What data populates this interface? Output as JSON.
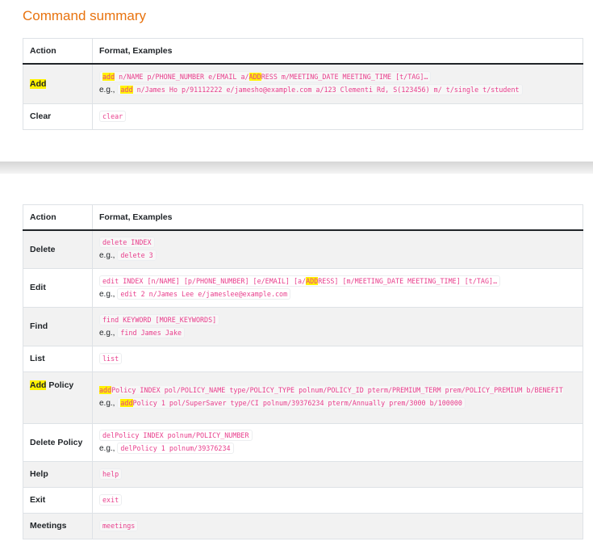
{
  "page_title": "Command summary",
  "table1": {
    "headers": {
      "action": "Action",
      "format": "Format, Examples"
    },
    "add": {
      "action": "Add",
      "cmd": "add",
      "format_rest_1": " n/NAME p/PHONE_NUMBER e/EMAIL a/",
      "format_hl": "ADD",
      "format_rest_2": "RESS m/MEETING_DATE MEETING_TIME [t/TAG]…",
      "eg_label": "e.g.,",
      "eg_cmd": "add",
      "eg_rest": " n/James Ho p/91112222 e/jamesho@example.com a/123 Clementi Rd, S(123456) m/ t/single t/student"
    },
    "clear": {
      "action": "Clear",
      "format": "clear"
    }
  },
  "table2": {
    "headers": {
      "action": "Action",
      "format": "Format, Examples"
    },
    "delete": {
      "action": "Delete",
      "format": "delete INDEX",
      "eg_label": "e.g.,",
      "eg": "delete 3"
    },
    "edit": {
      "action": "Edit",
      "format_1": "edit INDEX [n/NAME] [p/PHONE_NUMBER] [e/EMAIL] [a/",
      "format_hl": "ADD",
      "format_2": "RESS] [m/MEETING_DATE MEETING_TIME] [t/TAG]…",
      "eg_label": "e.g.,",
      "eg": "edit 2 n/James Lee e/jameslee@example.com"
    },
    "find": {
      "action": "Find",
      "format": "find KEYWORD [MORE_KEYWORDS]",
      "eg_label": "e.g.,",
      "eg": "find James Jake"
    },
    "list": {
      "action": "List",
      "format": "list"
    },
    "add_policy": {
      "action_hl": "Add",
      "action_rest": " Policy",
      "format_hl": "add",
      "format_rest": "Policy INDEX pol/POLICY_NAME type/POLICY_TYPE polnum/POLICY_ID pterm/PREMIUM_TERM prem/POLICY_PREMIUM b/BENEFIT",
      "eg_label": "e.g.,",
      "eg_hl": "add",
      "eg_rest": "Policy 1 pol/SuperSaver type/CI polnum/39376234 pterm/Annually prem/3000 b/100000"
    },
    "delete_policy": {
      "action": "Delete Policy",
      "format": "delPolicy INDEX polnum/POLICY_NUMBER",
      "eg_label": "e.g.,",
      "eg": "delPolicy 1 polnum/39376234"
    },
    "help": {
      "action": "Help",
      "format": "help"
    },
    "exit": {
      "action": "Exit",
      "format": "exit"
    },
    "meetings": {
      "action": "Meetings",
      "format": "meetings"
    }
  }
}
